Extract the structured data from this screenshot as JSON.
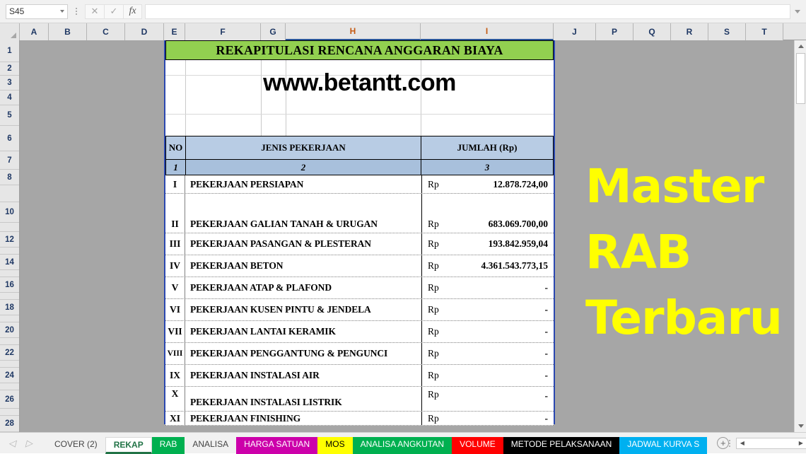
{
  "formula_bar": {
    "name_box_value": "S45",
    "name_box_placeholder": "Name Box",
    "cancel_icon": "close-icon",
    "confirm_icon": "check-icon",
    "function_icon": "fx-icon",
    "formula_value": "",
    "formula_placeholder": "",
    "expand_icon": "chevron-down-icon"
  },
  "grid": {
    "columns": [
      "A",
      "B",
      "C",
      "D",
      "E",
      "F",
      "G",
      "H",
      "I",
      "J",
      "P",
      "Q",
      "R",
      "S",
      "T"
    ],
    "selected_columns": [
      "H",
      "I"
    ],
    "rows": [
      "1",
      "2",
      "3",
      "4",
      "5",
      "6",
      "7",
      "8",
      "10",
      "12",
      "14",
      "16",
      "18",
      "20",
      "22",
      "24",
      "26",
      "28"
    ]
  },
  "sheet": {
    "title": "REKAPITULASI RENCANA ANGGARAN BIAYA",
    "title_bg": "#92d050",
    "watermark": "www.betantt.com",
    "table": {
      "headers": [
        "NO",
        "JENIS PEKERJAAN",
        "JUMLAH (Rp)"
      ],
      "header_bg": "#b8cce4",
      "number_row": [
        "1",
        "2",
        "3"
      ],
      "number_row_bg": "#a8c0dc",
      "currency_symbol": "Rp",
      "rows": [
        {
          "no": "I",
          "desc": "PEKERJAAN PERSIAPAN",
          "currency": "Rp",
          "amount": "12.878.724,00"
        },
        {
          "no": "II",
          "desc": "PEKERJAAN GALIAN TANAH & URUGAN",
          "currency": "Rp",
          "amount": "683.069.700,00"
        },
        {
          "no": "III",
          "desc": "PEKERJAAN PASANGAN & PLESTERAN",
          "currency": "Rp",
          "amount": "193.842.959,04"
        },
        {
          "no": "IV",
          "desc": "PEKERJAAN BETON",
          "currency": "Rp",
          "amount": "4.361.543.773,15"
        },
        {
          "no": "V",
          "desc": "PEKERJAAN ATAP & PLAFOND",
          "currency": "Rp",
          "amount": "-"
        },
        {
          "no": "VI",
          "desc": "PEKERJAAN KUSEN PINTU & JENDELA",
          "currency": "Rp",
          "amount": "-"
        },
        {
          "no": "VII",
          "desc": "PEKERJAAN LANTAI KERAMIK",
          "currency": "Rp",
          "amount": "-"
        },
        {
          "no": "VIII",
          "desc": "PEKERJAAN PENGGANTUNG & PENGUNCI",
          "currency": "Rp",
          "amount": "-"
        },
        {
          "no": "IX",
          "desc": "PEKERJAAN INSTALASI AIR",
          "currency": "Rp",
          "amount": "-"
        },
        {
          "no": "X",
          "desc": "PEKERJAAN INSTALASI LISTRIK",
          "currency": "Rp",
          "amount": "-"
        },
        {
          "no": "XI",
          "desc": "PEKERJAAN FINISHING",
          "currency": "Rp",
          "amount": "-"
        }
      ]
    }
  },
  "promo": {
    "line1": "Master",
    "line2": "RAB",
    "line3": "Terbaru",
    "color": "#ffff00"
  },
  "sheet_tabs": {
    "prev_icon": "chevron-left-icon",
    "next_icon": "chevron-right-icon",
    "add_label": "+",
    "items": [
      {
        "label": "COVER (2)",
        "bg": "transparent",
        "fg": "#444444",
        "active": false
      },
      {
        "label": "REKAP",
        "bg": "#ffffff",
        "fg": "#217346",
        "active": true
      },
      {
        "label": "RAB",
        "bg": "#00b050",
        "fg": "#ffffff",
        "active": false
      },
      {
        "label": "ANALISA",
        "bg": "transparent",
        "fg": "#444444",
        "active": false
      },
      {
        "label": "HARGA SATUAN",
        "bg": "#cc00aa",
        "fg": "#ffffff",
        "active": false
      },
      {
        "label": "MOS",
        "bg": "#ffff00",
        "fg": "#000000",
        "active": false
      },
      {
        "label": "ANALISA ANGKUTAN",
        "bg": "#00b050",
        "fg": "#ffffff",
        "active": false
      },
      {
        "label": "VOLUME",
        "bg": "#ff0000",
        "fg": "#ffffff",
        "active": false
      },
      {
        "label": "METODE PELAKSANAAN",
        "bg": "#000000",
        "fg": "#ffffff",
        "active": false
      },
      {
        "label": "JADWAL KURVA S",
        "bg": "#00b0f0",
        "fg": "#ffffff",
        "active": false
      }
    ]
  }
}
